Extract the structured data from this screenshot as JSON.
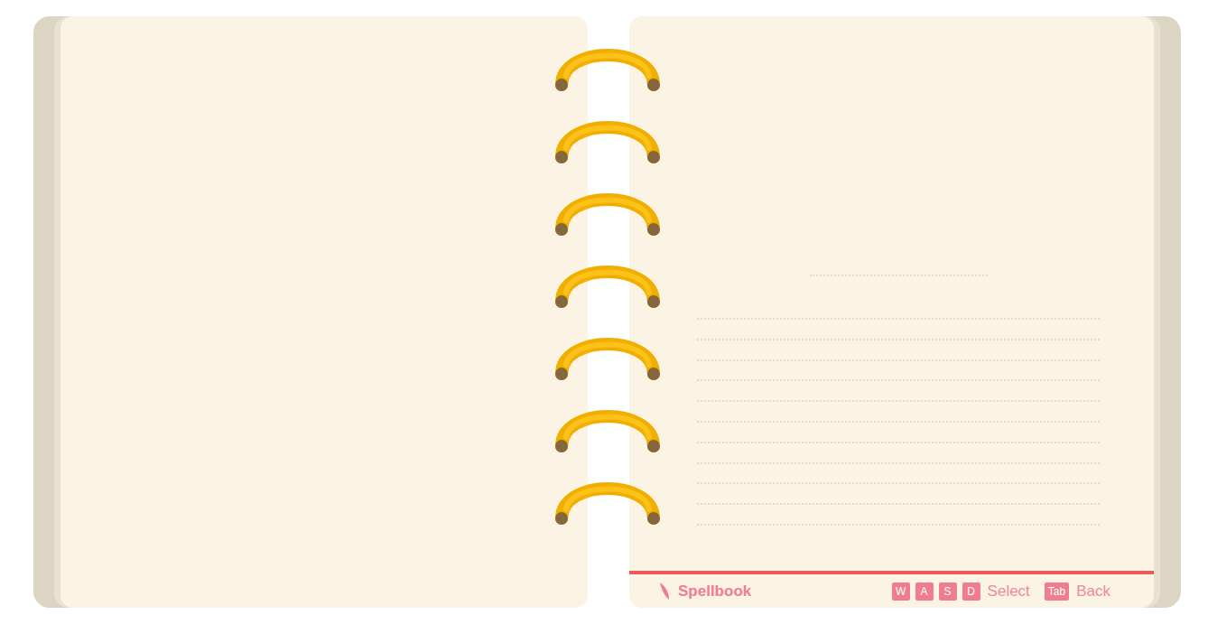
{
  "footer": {
    "title": "Spellbook",
    "controls": [
      {
        "keys": [
          "W",
          "A",
          "S",
          "D"
        ],
        "label": "Select"
      },
      {
        "keys": [
          "Tab"
        ],
        "label": "Back"
      }
    ]
  }
}
